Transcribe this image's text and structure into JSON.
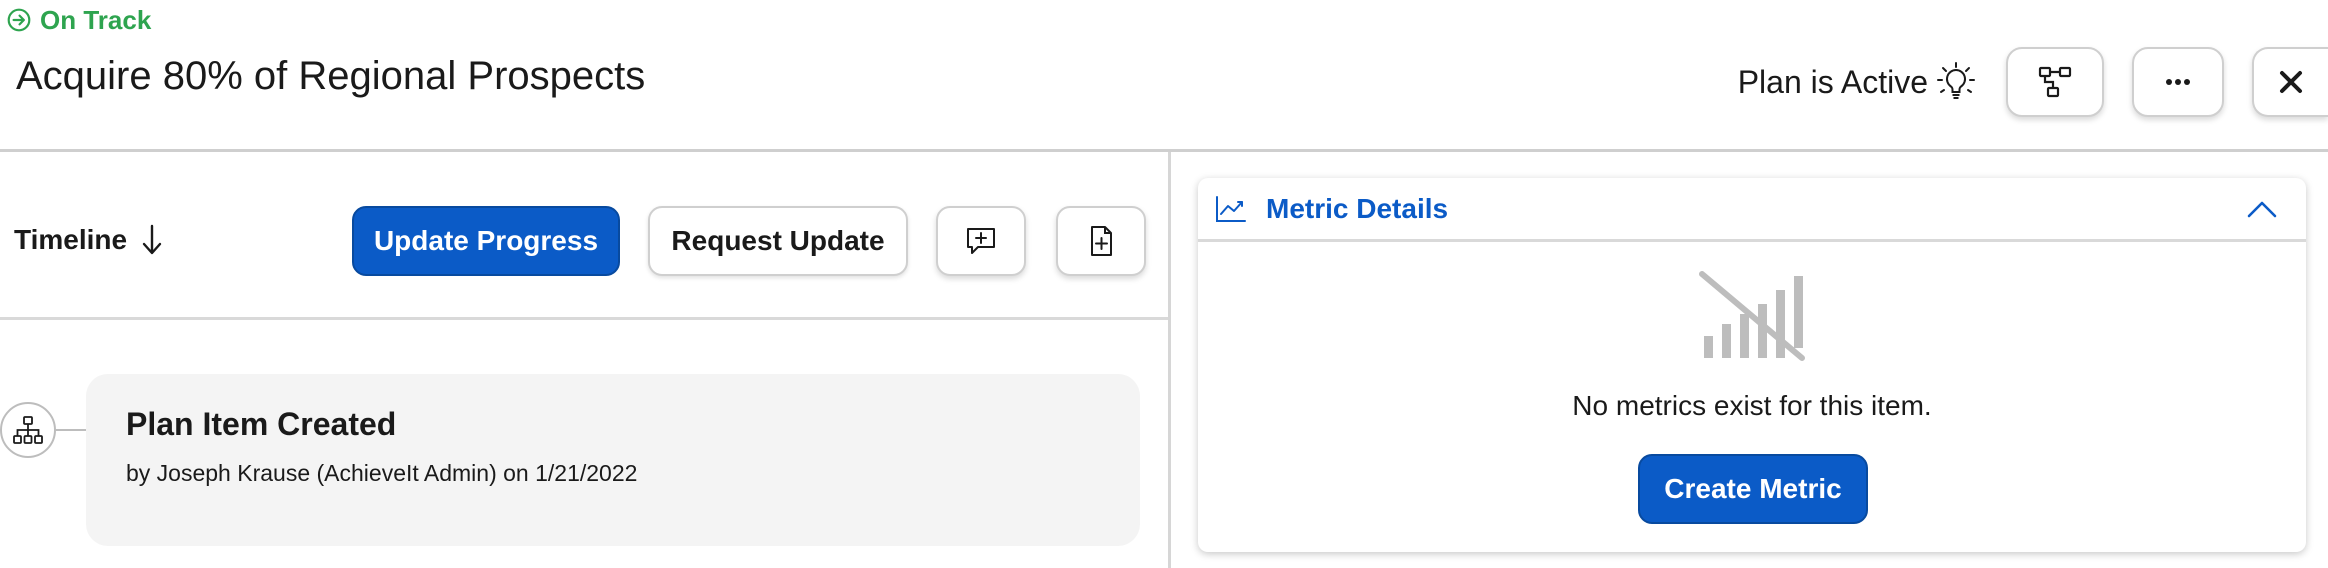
{
  "header": {
    "status": "On Track",
    "title": "Acquire 80% of Regional Prospects",
    "plan_status": "Plan is Active"
  },
  "toolbar": {
    "timeline_label": "Timeline",
    "update_progress_label": "Update Progress",
    "request_update_label": "Request Update"
  },
  "timeline": {
    "events": [
      {
        "title": "Plan Item Created",
        "subtitle": "by Joseph Krause (AchieveIt Admin) on 1/21/2022"
      }
    ]
  },
  "metrics": {
    "title": "Metric Details",
    "empty_text": "No metrics exist for this item.",
    "create_label": "Create Metric"
  },
  "icons": {
    "status": "arrow-circle-right-icon",
    "plan_active": "lightbulb-icon",
    "hierarchy": "hierarchy-icon",
    "more": "ellipsis-icon",
    "close": "close-icon",
    "sort": "arrow-down-icon",
    "comment": "comment-add-icon",
    "document": "document-add-icon",
    "timeline_node": "org-chart-icon",
    "metric_header": "chart-line-icon",
    "collapse": "chevron-up-icon",
    "empty_metric": "no-signal-chart-icon"
  },
  "colors": {
    "status_green": "#2ea44f",
    "primary_blue": "#0b5bc7",
    "card_bg": "#f4f4f4"
  }
}
